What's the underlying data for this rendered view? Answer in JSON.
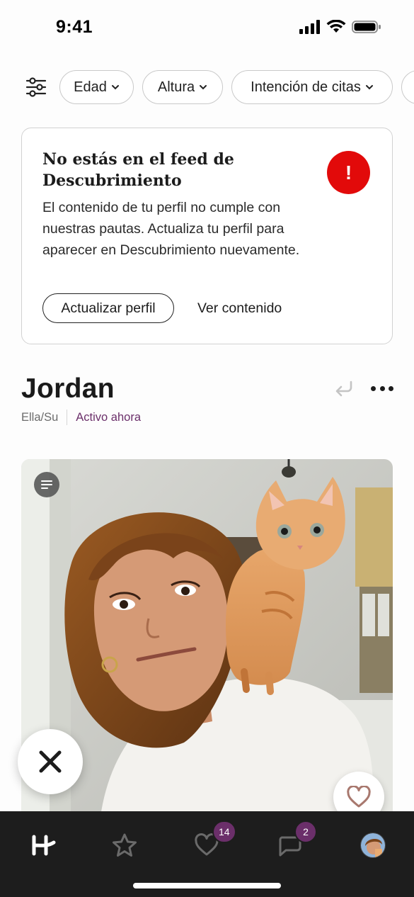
{
  "status_bar": {
    "time": "9:41"
  },
  "filters": {
    "chips": [
      {
        "label": "Edad"
      },
      {
        "label": "Altura"
      },
      {
        "label": "Intención de citas"
      }
    ]
  },
  "alert": {
    "title": "No estás en el feed de Descubrimiento",
    "badge": "!",
    "body": "El contenido de tu perfil no cumple con nuestras pautas. Actualiza tu perfil para aparecer en Descubrimiento nuevamente.",
    "primary_action": "Actualizar perfil",
    "secondary_action": "Ver contenido",
    "badge_color": "#e20a0a"
  },
  "profile": {
    "name": "Jordan",
    "pronouns": "Ella/Su",
    "activity": "Activo ahora",
    "accent_color": "#6b2f6a"
  },
  "bottom_nav": {
    "items": [
      {
        "name": "home",
        "icon": "hinge-logo-icon"
      },
      {
        "name": "standouts",
        "icon": "star-icon"
      },
      {
        "name": "likes",
        "icon": "heart-icon",
        "badge": "14"
      },
      {
        "name": "messages",
        "icon": "chat-icon",
        "badge": "2"
      },
      {
        "name": "profile",
        "icon": "avatar"
      }
    ]
  }
}
